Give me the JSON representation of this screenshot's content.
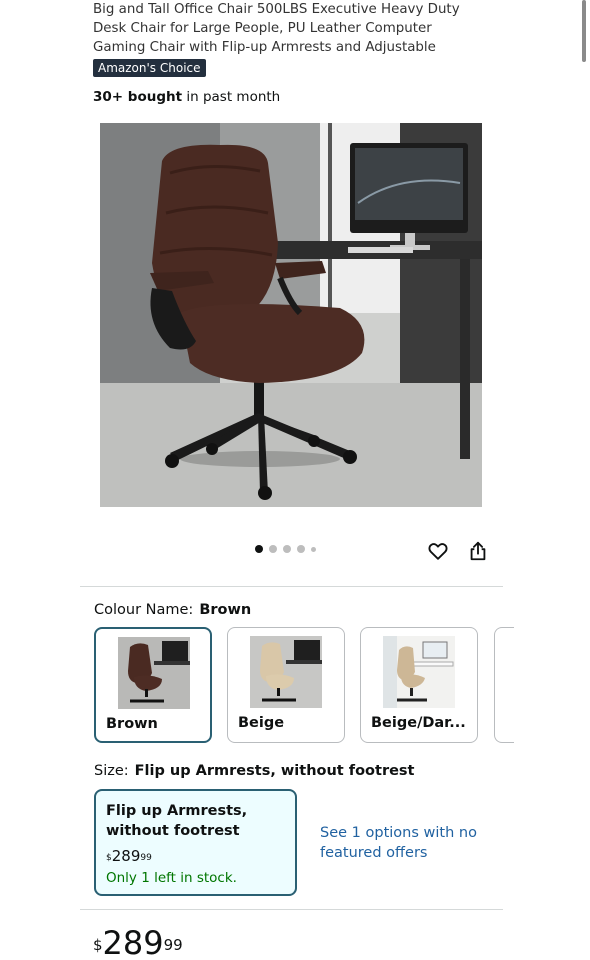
{
  "product": {
    "title": "Big and Tall Office Chair 500LBS Executive Heavy Duty Desk Chair for Large People, PU Leather Computer Gaming Chair with Flip-up Armrests and Adjustable Height (Brown)",
    "badge": "Amazon's Choice",
    "bought_count": "30+ bought",
    "bought_suffix": " in past month",
    "image_alt": "Brown leather executive office chair beside a desk with a monitor"
  },
  "carousel": {
    "dots": 5,
    "active_index": 0
  },
  "actions": {
    "favorite_icon": "heart-icon",
    "share_icon": "share-icon"
  },
  "colour": {
    "label": "Colour Name:",
    "selected": "Brown",
    "options": [
      {
        "label": "Brown",
        "selected": true,
        "chair_color": "#4a2a22"
      },
      {
        "label": "Beige",
        "selected": false,
        "chair_color": "#d9c7a8"
      },
      {
        "label": "Beige/Dar...",
        "selected": false,
        "chair_color": "#cdb796"
      }
    ]
  },
  "size": {
    "label": "Size:",
    "selected": "Flip up Armrests,  without footrest",
    "option": {
      "name": "Flip up Armrests, without footrest",
      "price_symbol": "$",
      "price_whole": "289",
      "price_fraction": "99",
      "stock": "Only 1 left in stock."
    },
    "see_options": "See 1 options with no featured offers"
  },
  "price": {
    "symbol": "$",
    "whole": "289",
    "fraction": "99"
  },
  "colors": {
    "accent_border": "#2a6073",
    "link": "#2162a1",
    "in_stock": "#007600",
    "badge_bg": "#232f3e"
  }
}
